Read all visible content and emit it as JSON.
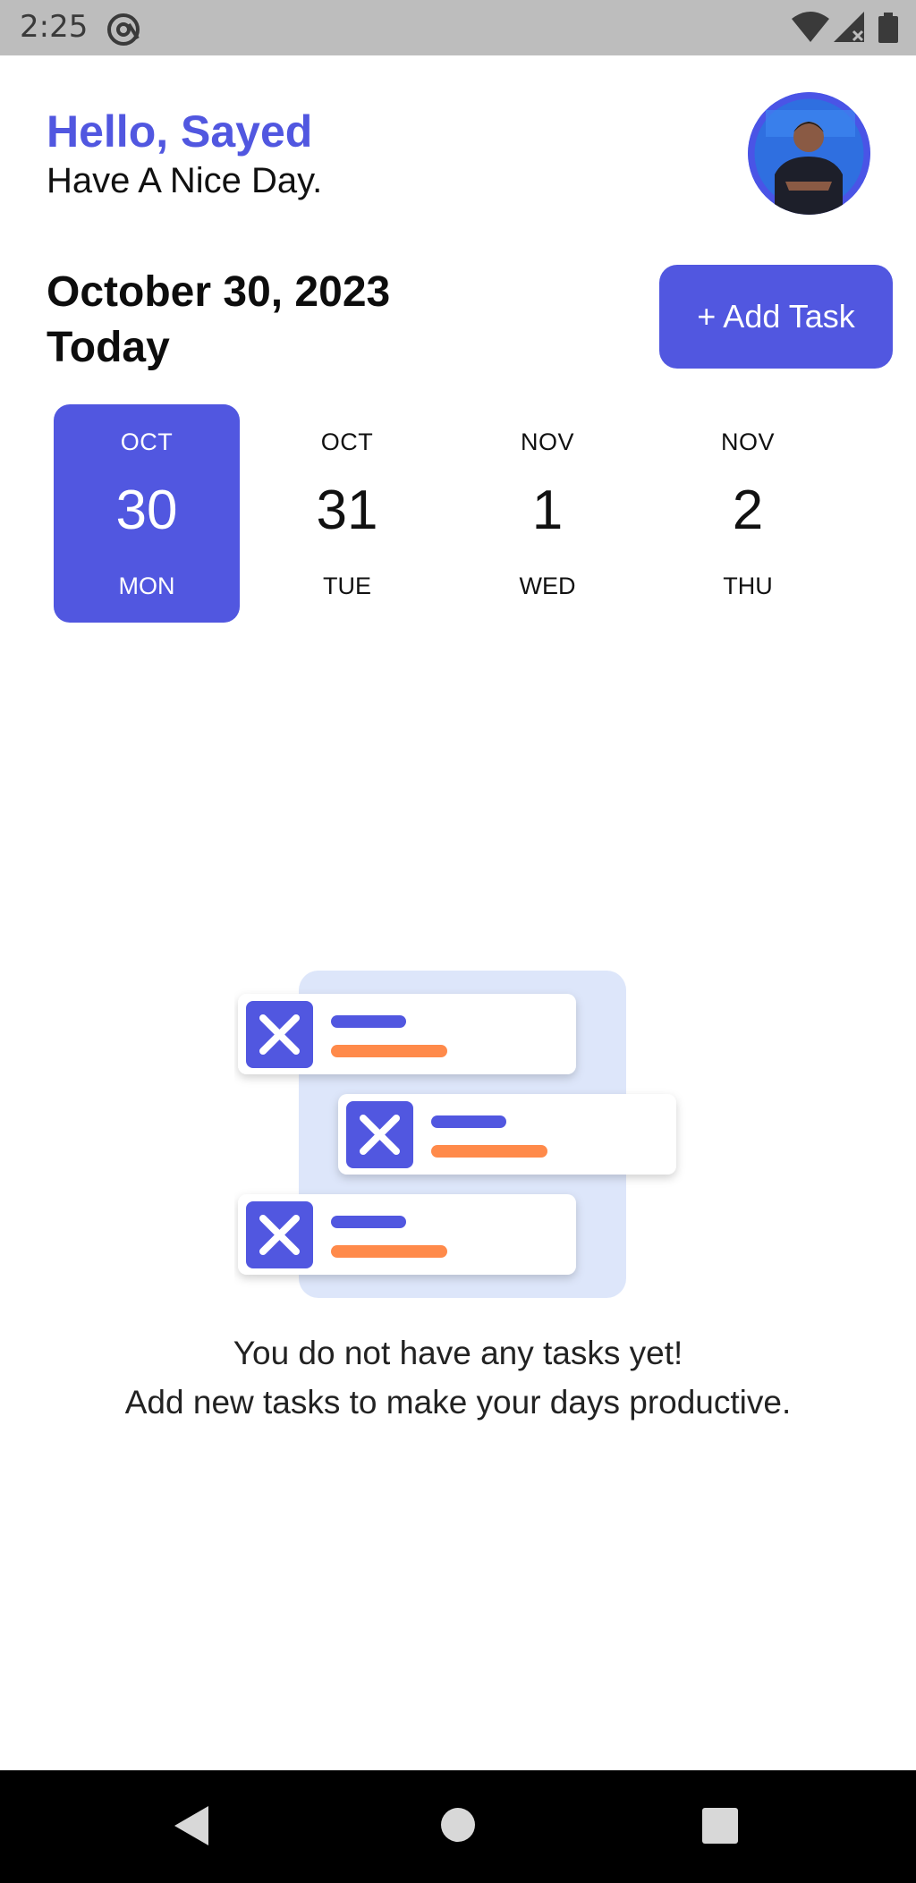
{
  "status_bar": {
    "time": "2:25",
    "icons": [
      "at-sign-icon",
      "wifi-icon",
      "signal-icon",
      "battery-icon"
    ]
  },
  "header": {
    "greeting": "Hello, Sayed",
    "subgreeting": "Have A Nice Day.",
    "avatar": "profile-avatar"
  },
  "date_section": {
    "date_line": "October 30, 2023",
    "today_label": "Today",
    "add_task_label": "+ Add Task"
  },
  "days": [
    {
      "month": "OCT",
      "day": "30",
      "weekday": "MON",
      "selected": true
    },
    {
      "month": "OCT",
      "day": "31",
      "weekday": "TUE",
      "selected": false
    },
    {
      "month": "NOV",
      "day": "1",
      "weekday": "WED",
      "selected": false
    },
    {
      "month": "NOV",
      "day": "2",
      "weekday": "THU",
      "selected": false
    }
  ],
  "empty_state": {
    "line1": "You do not have any tasks yet!",
    "line2": "Add new tasks to make your days productive."
  },
  "nav_bar": {
    "icons": [
      "back-icon",
      "home-icon",
      "recents-icon"
    ]
  },
  "colors": {
    "accent": "#5157e0",
    "orange": "#ff8a4a",
    "illustration_bg": "#dde6fa",
    "status_bar": "#bdbdbd",
    "nav_bar": "#000000"
  }
}
